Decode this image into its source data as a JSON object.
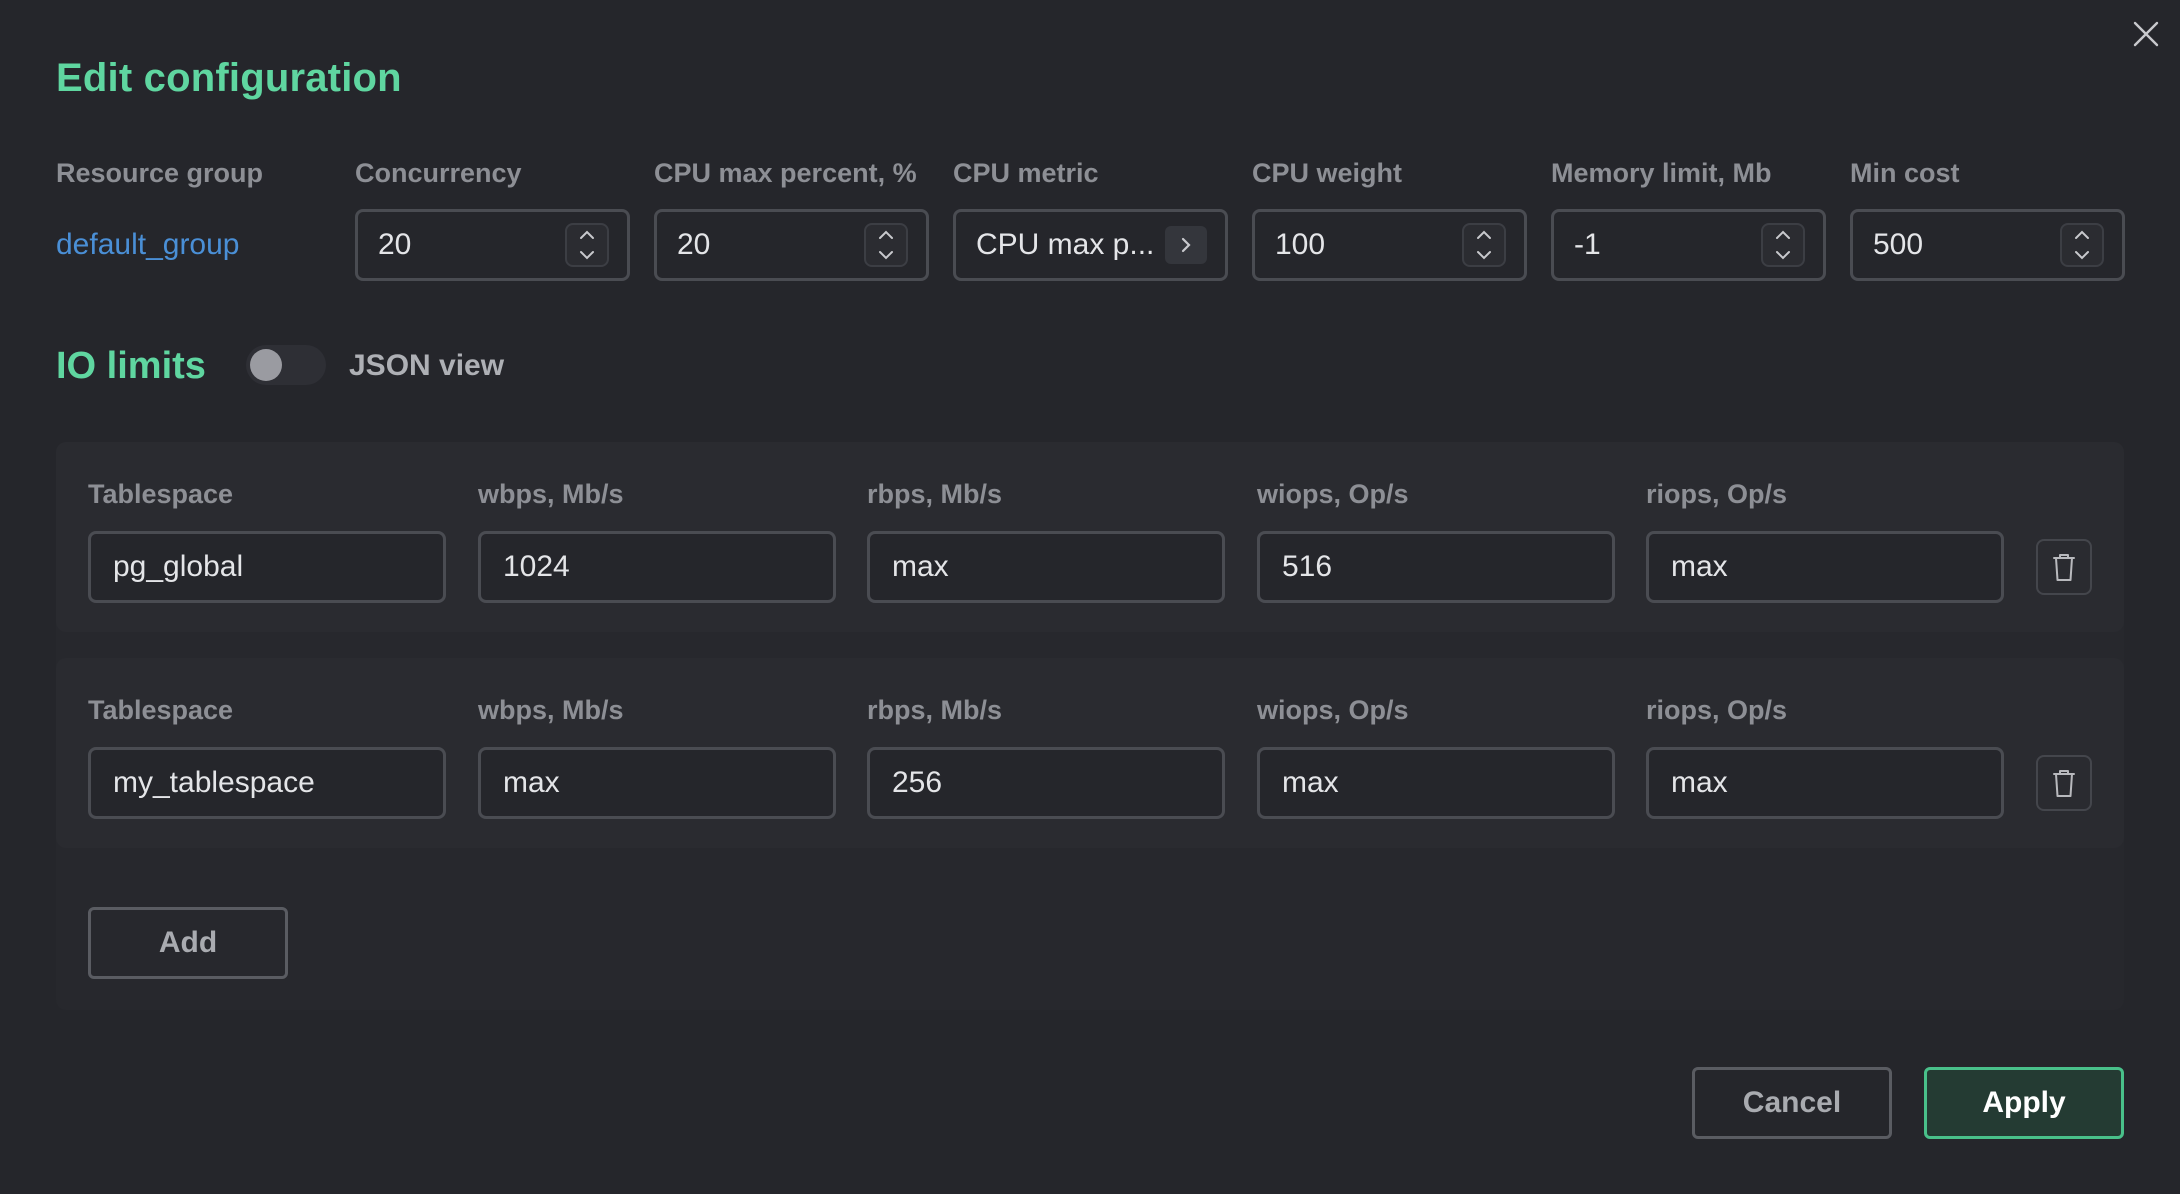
{
  "title": "Edit configuration",
  "config": {
    "labels": {
      "resource_group": "Resource group",
      "concurrency": "Concurrency",
      "cpu_max_percent": "CPU max percent, %",
      "cpu_metric": "CPU metric",
      "cpu_weight": "CPU weight",
      "memory_limit": "Memory limit, Mb",
      "min_cost": "Min cost"
    },
    "resource_group": "default_group",
    "concurrency": "20",
    "cpu_max_percent": "20",
    "cpu_metric": "CPU max p...",
    "cpu_weight": "100",
    "memory_limit": "-1",
    "min_cost": "500"
  },
  "io": {
    "title": "IO limits",
    "json_view_label": "JSON view",
    "json_view_enabled": false,
    "headers": {
      "tablespace": "Tablespace",
      "wbps": "wbps, Mb/s",
      "rbps": "rbps, Mb/s",
      "wiops": "wiops, Op/s",
      "riops": "riops, Op/s"
    },
    "rows": [
      {
        "tablespace": "pg_global",
        "wbps": "1024",
        "rbps": "max",
        "wiops": "516",
        "riops": "max"
      },
      {
        "tablespace": "my_tablespace",
        "wbps": "max",
        "rbps": "256",
        "wiops": "max",
        "riops": "max"
      }
    ],
    "add_label": "Add"
  },
  "footer": {
    "cancel_label": "Cancel",
    "apply_label": "Apply"
  },
  "colors": {
    "accent_green": "#5fd6a0",
    "link_blue": "#4a8fd6",
    "background": "#25262b"
  },
  "icons": {
    "close": "close-icon",
    "stepper_up": "chevron-up-icon",
    "stepper_down": "chevron-down-icon",
    "metric_open": "chevron-right-icon",
    "delete_row": "trash-icon"
  }
}
